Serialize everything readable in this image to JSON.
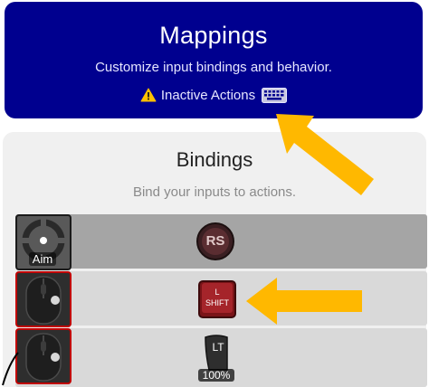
{
  "header": {
    "title": "Mappings",
    "subtitle": "Customize input bindings and behavior.",
    "inactive_label": "Inactive Actions",
    "warning_icon": "warning-icon",
    "keyboard_icon": "keyboard-icon",
    "bg_color": "#00008f"
  },
  "bindings": {
    "title": "Bindings",
    "subtitle": "Bind your inputs to actions.",
    "rows": [
      {
        "action_label": "Aim",
        "action_icon": "aim-icon",
        "input_label": "RS",
        "input_icon": "right-stick-icon"
      },
      {
        "action_icon": "mouse-icon",
        "input_label_top": "L",
        "input_label_bottom": "SHIFT",
        "input_icon": "left-shift-key-icon"
      },
      {
        "action_icon": "mouse-icon",
        "input_label": "LT",
        "input_value": "100%",
        "input_icon": "left-trigger-icon"
      }
    ]
  },
  "annotations": {
    "arrow_color": "#ffb800",
    "arrows": [
      "arrow-to-inactive-actions",
      "arrow-to-shift-binding"
    ]
  }
}
